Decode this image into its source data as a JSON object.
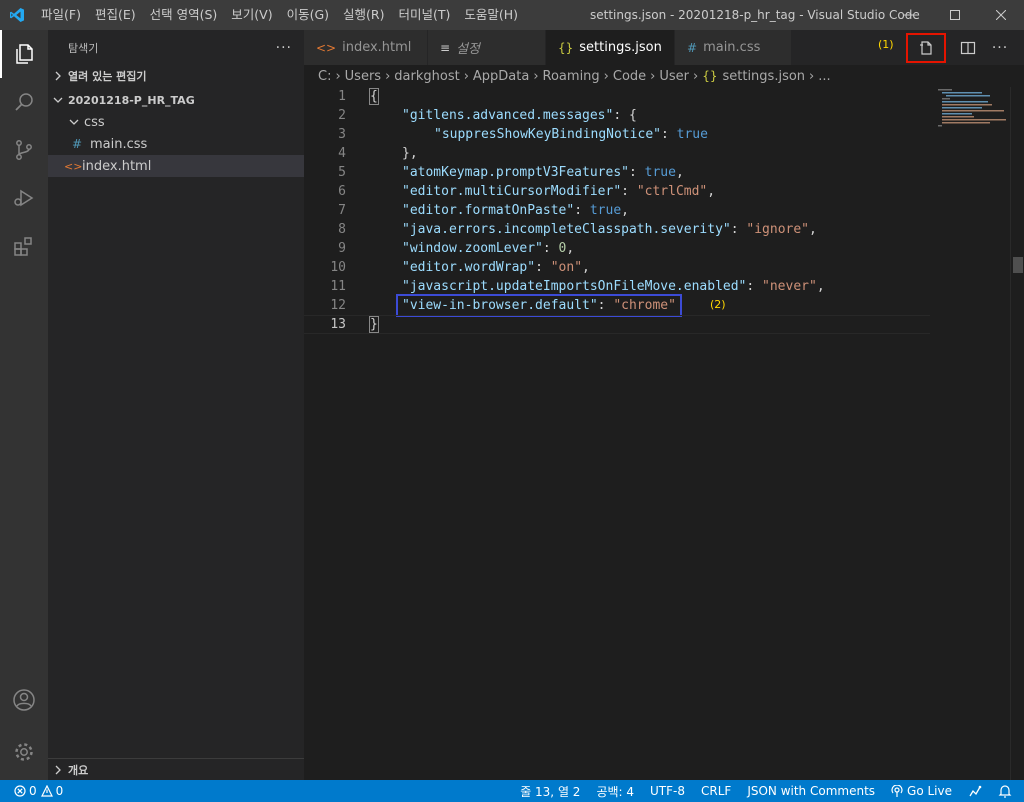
{
  "titlebar": {
    "menu": [
      "파일(F)",
      "편집(E)",
      "선택 영역(S)",
      "보기(V)",
      "이동(G)",
      "실행(R)",
      "터미널(T)",
      "도움말(H)"
    ],
    "window_title": "settings.json - 20201218-p_hr_tag - Visual Studio Code"
  },
  "activitybar": {
    "items": [
      "explorer-icon",
      "search-icon",
      "source-control-icon",
      "run-debug-icon",
      "extensions-icon"
    ],
    "bottom": [
      "account-icon",
      "manage-gear-icon"
    ]
  },
  "sidebar": {
    "title": "탐색기",
    "open_editors": "열려 있는 편집기",
    "folder": "20201218-P_HR_TAG",
    "tree": [
      {
        "label": "css",
        "type": "folder"
      },
      {
        "label": "main.css",
        "type": "css"
      },
      {
        "label": "index.html",
        "type": "html"
      }
    ],
    "outline": "개요"
  },
  "tabs": [
    {
      "label": "index.html",
      "icon": "<>",
      "active": false
    },
    {
      "label": "설정",
      "icon": "≡",
      "active": false,
      "preview": true
    },
    {
      "label": "settings.json",
      "icon": "{}",
      "active": true
    },
    {
      "label": "main.css",
      "icon": "#",
      "active": false
    }
  ],
  "annotations": {
    "first": "(1)",
    "second": "(2)"
  },
  "colors": {
    "annotation_red": "#e51400",
    "annotation_blue": "#3c4bd6",
    "status_blue": "#007acc"
  },
  "breadcrumb": [
    "C:",
    "Users",
    "darkghost",
    "AppData",
    "Roaming",
    "Code",
    "User",
    "settings.json",
    "..."
  ],
  "code_lines": [
    {
      "num": "1",
      "key": "",
      "sep": "",
      "val": "",
      "tail": "{"
    },
    {
      "num": "2",
      "key": "\"gitlens.advanced.messages\"",
      "sep": ": ",
      "val": "",
      "tail": "{"
    },
    {
      "num": "3",
      "key": "\"suppresShowKeyBindingNotice\"",
      "sep": ": ",
      "val": "true",
      "tail": ""
    },
    {
      "num": "4",
      "key": "",
      "sep": "",
      "val": "",
      "tail": "},"
    },
    {
      "num": "5",
      "key": "\"atomKeymap.promptV3Features\"",
      "sep": ": ",
      "val": "true",
      "tail": ","
    },
    {
      "num": "6",
      "key": "\"editor.multiCursorModifier\"",
      "sep": ": ",
      "val": "\"ctrlCmd\"",
      "tail": ","
    },
    {
      "num": "7",
      "key": "\"editor.formatOnPaste\"",
      "sep": ": ",
      "val": "true",
      "tail": ","
    },
    {
      "num": "8",
      "key": "\"java.errors.incompleteClasspath.severity\"",
      "sep": ": ",
      "val": "\"ignore\"",
      "tail": ","
    },
    {
      "num": "9",
      "key": "\"window.zoomLever\"",
      "sep": ": ",
      "val": "0",
      "tail": ","
    },
    {
      "num": "10",
      "key": "\"editor.wordWrap\"",
      "sep": ": ",
      "val": "\"on\"",
      "tail": ","
    },
    {
      "num": "11",
      "key": "\"javascript.updateImportsOnFileMove.enabled\"",
      "sep": ": ",
      "val": "\"never\"",
      "tail": ","
    },
    {
      "num": "12",
      "key": "\"view-in-browser.default\"",
      "sep": ": ",
      "val": "\"chrome\"",
      "tail": ""
    },
    {
      "num": "13",
      "key": "",
      "sep": "",
      "val": "",
      "tail": "}"
    }
  ],
  "statusbar": {
    "errors": "0",
    "warnings": "0",
    "position": "줄 13, 열 2",
    "indent": "공백: 4",
    "encoding": "UTF-8",
    "eol": "CRLF",
    "language": "JSON with Comments",
    "golive": "Go Live"
  }
}
